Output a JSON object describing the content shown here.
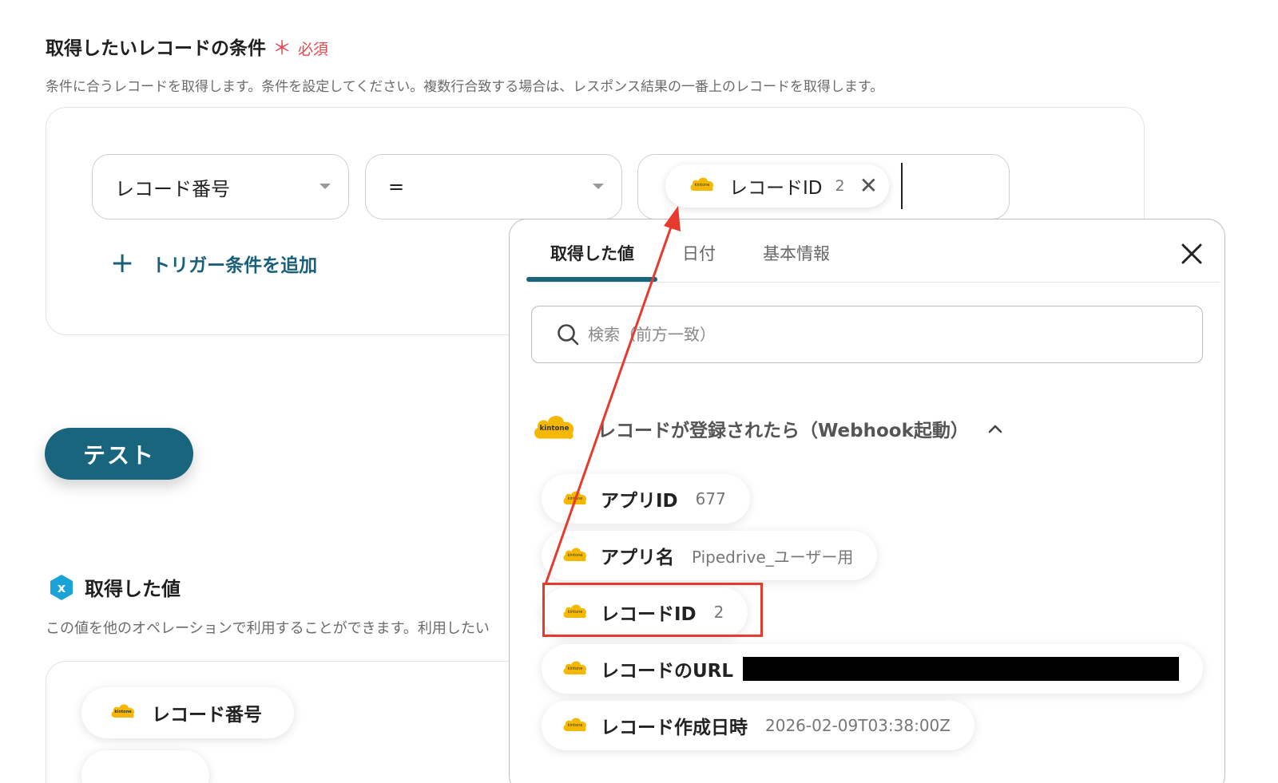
{
  "condition": {
    "title": "取得したいレコードの条件",
    "required_mark": "＊",
    "required_label": "必須",
    "description": "条件に合うレコードを取得します。条件を設定してください。複数行合致する場合は、レスポンス結果の一番上のレコードを取得します。",
    "field_select": "レコード番号",
    "operator_select": "=",
    "value_chip": {
      "label": "レコードID",
      "number": "2",
      "remove": "✕"
    },
    "add_trigger_plus": "+",
    "add_trigger_label": "トリガー条件を追加"
  },
  "test_button": "テスト",
  "output": {
    "title": "取得した値",
    "description": "この値を他のオペレーションで利用することができます。利用したい",
    "chips": [
      "レコード番号",
      ""
    ]
  },
  "popover": {
    "tabs": [
      "取得した値",
      "日付",
      "基本情報"
    ],
    "active_tab": 0,
    "search_placeholder": "検索（前方一致）",
    "group_title": "レコードが登録されたら（Webhook起動）",
    "items": [
      {
        "label": "アプリID",
        "value": "677"
      },
      {
        "label": "アプリ名",
        "value": "Pipedrive_ユーザー用"
      },
      {
        "label": "レコードID",
        "value": "2"
      },
      {
        "label": "レコードのURL",
        "value": ""
      },
      {
        "label": "レコード作成日時",
        "value": "2026-02-09T03:38:00Z"
      }
    ],
    "highlighted_item": 2
  },
  "icons": {
    "app_icon": "kintone-cloud-icon",
    "app_icon_text": "kintone",
    "app_icon_color": "#f5b800",
    "variable_badge": "variable-x-icon",
    "variable_badge_color": "#1aa3d9"
  },
  "colors": {
    "primary": "#1a657e",
    "required": "#e5484d",
    "annotation": "#e63a2e"
  }
}
